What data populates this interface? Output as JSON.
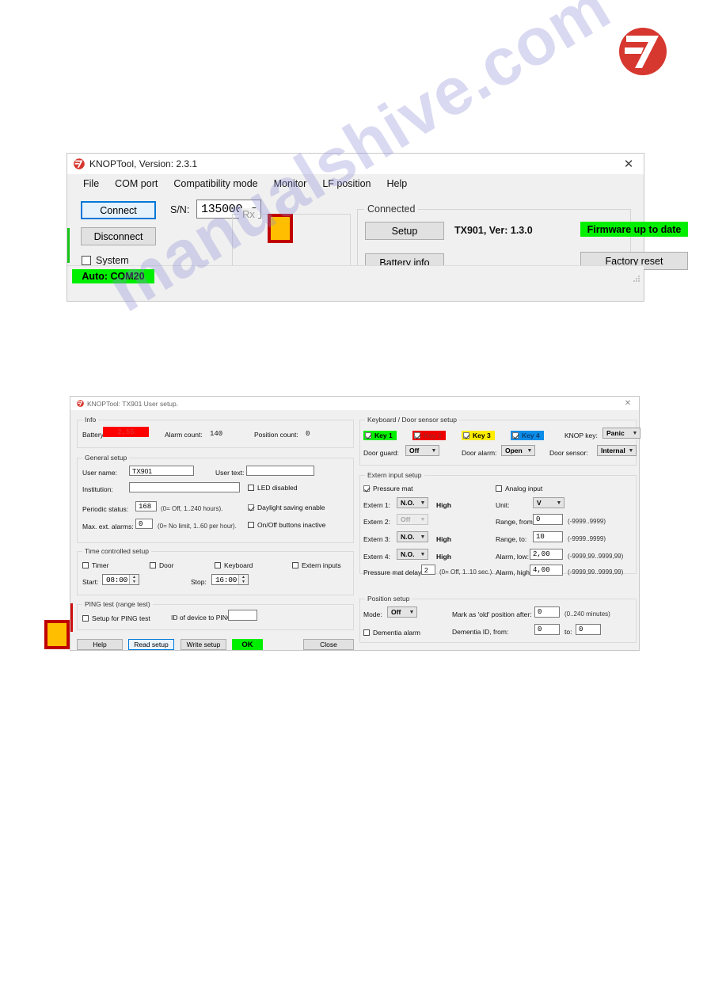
{
  "page": {
    "logo_icon": "knop-logo-icon",
    "watermark": "manualshive.com"
  },
  "window1": {
    "title": "KNOPTool, Version: 2.3.1",
    "close_icon": "close-icon",
    "menu": [
      "File",
      "COM port",
      "Compatibility mode",
      "Monitor",
      "LF position",
      "Help"
    ],
    "connect_label": "Connect",
    "disconnect_label": "Disconnect",
    "system_label": "System",
    "sn_label": "S/N:",
    "sn_value": "135000",
    "rx_group_label": "Rx",
    "connected_group_label": "Connected",
    "setup_label": "Setup",
    "battery_info_label": "Battery info",
    "device_version": "TX901, Ver: 1.3.0",
    "firmware_badge": "Firmware up to date",
    "factory_reset_label": "Factory reset",
    "status_badge": "Auto: COM20"
  },
  "window2": {
    "title": "KNOPTool: TX901 User setup.",
    "close_icon": "close-icon",
    "info": {
      "group_label": "Info",
      "battery_label": "Battery:",
      "battery_value": "2,55",
      "alarm_count_label": "Alarm count:",
      "alarm_count_value": "140",
      "position_count_label": "Position count:",
      "position_count_value": "0"
    },
    "general": {
      "group_label": "General setup",
      "user_name_label": "User name:",
      "user_name_value": "TX901",
      "user_text_label": "User text:",
      "user_text_value": "",
      "institution_label": "Institution:",
      "institution_value": "",
      "periodic_label": "Periodic status:",
      "periodic_value": "168",
      "periodic_hint": "(0= Off, 1..240 hours).",
      "max_alarms_label": "Max. ext. alarms:",
      "max_alarms_value": "0",
      "max_alarms_hint": "(0= No limit, 1..60 per hour).",
      "led_disabled_label": "LED disabled",
      "daylight_label": "Daylight saving enable",
      "onoff_label": "On/Off buttons inactive"
    },
    "time": {
      "group_label": "Time controlled setup",
      "timer_label": "Timer",
      "door_label": "Door",
      "keyboard_label": "Keyboard",
      "extern_inputs_label": "Extern inputs",
      "start_label": "Start:",
      "start_value": "08:00",
      "stop_label": "Stop:",
      "stop_value": "16:00"
    },
    "ping": {
      "group_label": "PING test (range test)",
      "setup_label": "Setup for PING test",
      "id_label": "ID of device to PING:",
      "id_value": ""
    },
    "keyboard": {
      "group_label": "Keyboard / Door sensor setup",
      "keys": [
        {
          "label": "Key 1",
          "color": "#00ef00",
          "text_color": "#000000"
        },
        {
          "label": "Key 2",
          "color": "#ee0000",
          "text_color": "#aa2222"
        },
        {
          "label": "Key 3",
          "color": "#ffec00",
          "text_color": "#000000"
        },
        {
          "label": "Key 4",
          "color": "#0b8ce8",
          "text_color": "#0a3f6e"
        }
      ],
      "knop_key_label": "KNOP key:",
      "knop_key_value": "Panic",
      "door_guard_label": "Door guard:",
      "door_guard_value": "Off",
      "door_alarm_label": "Door alarm:",
      "door_alarm_value": "Open",
      "door_sensor_label": "Door sensor:",
      "door_sensor_value": "Internal"
    },
    "extern": {
      "group_label": "Extern input setup",
      "pressure_mat_label": "Pressure mat",
      "analog_input_label": "Analog input",
      "rows": [
        {
          "label": "Extern 1:",
          "value": "N.O.",
          "state": "High",
          "disabled": false
        },
        {
          "label": "Extern 2:",
          "value": "Off",
          "state": "",
          "disabled": true
        },
        {
          "label": "Extern 3:",
          "value": "N.O.",
          "state": "High",
          "disabled": false
        },
        {
          "label": "Extern 4:",
          "value": "N.O.",
          "state": "High",
          "disabled": false
        }
      ],
      "delay_label": "Pressure mat delay:",
      "delay_value": "2",
      "delay_hint": "(0= Off, 1..10 sec.).",
      "unit_label": "Unit:",
      "unit_value": "V",
      "range_from_label": "Range, from:",
      "range_from_value": "0",
      "range_from_hint": "(-9999..9999)",
      "range_to_label": "Range, to:",
      "range_to_value": "10",
      "range_to_hint": "(-9999..9999)",
      "alarm_low_label": "Alarm, low:",
      "alarm_low_value": "2,00",
      "alarm_low_hint": "(-9999,99..9999,99)",
      "alarm_high_label": "Alarm, high:",
      "alarm_high_value": "4,00",
      "alarm_high_hint": "(-9999,99..9999,99)"
    },
    "position": {
      "group_label": "Position setup",
      "mode_label": "Mode:",
      "mode_value": "Off",
      "mark_old_label": "Mark as 'old' position after:",
      "mark_old_value": "0",
      "mark_old_hint": "(0..240 minutes)",
      "dementia_alarm_label": "Dementia alarm",
      "dementia_id_label": "Dementia ID, from:",
      "dementia_from_value": "0",
      "dementia_to_label": "to:",
      "dementia_to_value": "0"
    },
    "buttons": {
      "help": "Help",
      "read_setup": "Read setup",
      "write_setup": "Write setup",
      "ok": "OK",
      "close": "Close"
    }
  }
}
